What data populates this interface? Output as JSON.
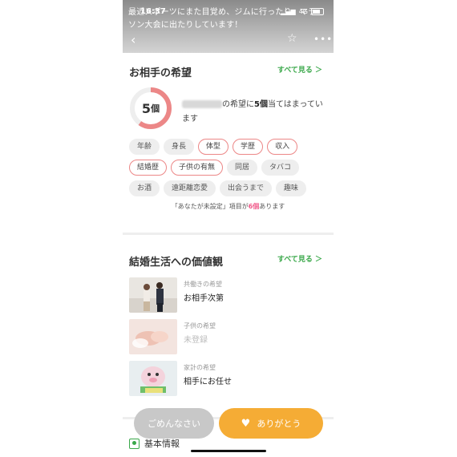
{
  "status_bar": {
    "time": "16:37",
    "signal": "4G"
  },
  "header": {
    "intro_text": "最近スポーツにまた目覚め、ジムに行ったり、マラソン大会に出たりしています！",
    "back_icon": "back-chevron-icon",
    "favorite_icon": "star-icon",
    "more_icon": "more-dots-icon"
  },
  "partner_wishes": {
    "title": "お相手の希望",
    "see_all": "すべて見る ＞",
    "match_count_number": "5",
    "match_count_unit": "個",
    "match_fraction": 0.6,
    "match_text_prefix": "の希望に",
    "match_text_count": "5個",
    "match_text_suffix": "当てはまっています",
    "tags": [
      [
        {
          "label": "年齢",
          "matched": false
        },
        {
          "label": "身長",
          "matched": false
        },
        {
          "label": "体型",
          "matched": true
        },
        {
          "label": "学歴",
          "matched": true
        },
        {
          "label": "収入",
          "matched": true
        }
      ],
      [
        {
          "label": "結婚歴",
          "matched": true
        },
        {
          "label": "子供の有無",
          "matched": true
        },
        {
          "label": "同居",
          "matched": false
        },
        {
          "label": "タバコ",
          "matched": false
        }
      ],
      [
        {
          "label": "お酒",
          "matched": false
        },
        {
          "label": "遠距離恋愛",
          "matched": false
        },
        {
          "label": "出会うまで",
          "matched": false
        },
        {
          "label": "趣味",
          "matched": false
        }
      ]
    ],
    "unset_prefix": "「あなたが未設定」項目が",
    "unset_count": "6個",
    "unset_suffix": "あります"
  },
  "marriage_values": {
    "title": "結婚生活への価値観",
    "see_all": "すべて見る ＞",
    "items": [
      {
        "label": "共働きの希望",
        "value": "お相手次第"
      },
      {
        "label": "子供の希望",
        "value": "未登録"
      },
      {
        "label": "家計の希望",
        "value": "相手にお任せ"
      }
    ]
  },
  "basic_info": {
    "label": "基本情報"
  },
  "actions": {
    "sorry": "ごめんなさい",
    "thanks": "ありがとう"
  },
  "colors": {
    "accent_green": "#3aa84a",
    "match_pink": "#ec8787",
    "thanks_orange": "#f5ac35",
    "sorry_gray": "#c8c8c8"
  }
}
